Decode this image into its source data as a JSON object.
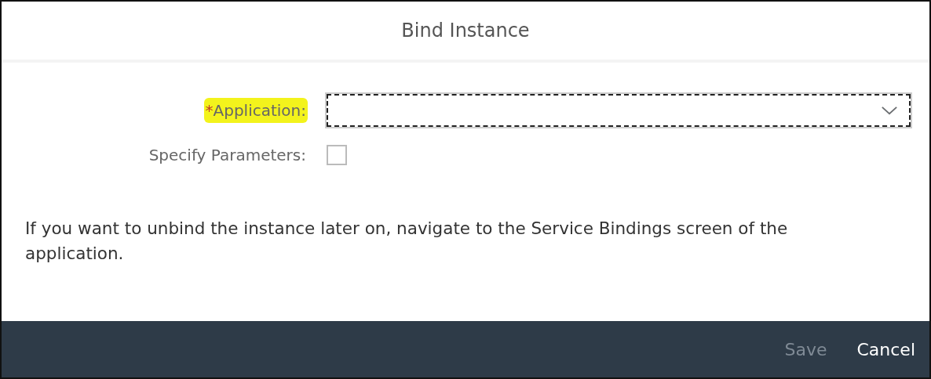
{
  "dialog": {
    "title": "Bind Instance"
  },
  "fields": [
    {
      "kind": "dropdown",
      "label": "Application:",
      "required_mark": "*",
      "highlighted": true,
      "focused": true
    },
    {
      "kind": "checkbox",
      "label": "Specify Parameters:",
      "highlighted": false,
      "checked": false
    }
  ],
  "message": "If you want to unbind the instance later on, navigate to the Service Bindings screen of the application.",
  "buttons": [
    {
      "label": "Save",
      "disabled": true
    },
    {
      "label": "Cancel",
      "disabled": false
    }
  ]
}
